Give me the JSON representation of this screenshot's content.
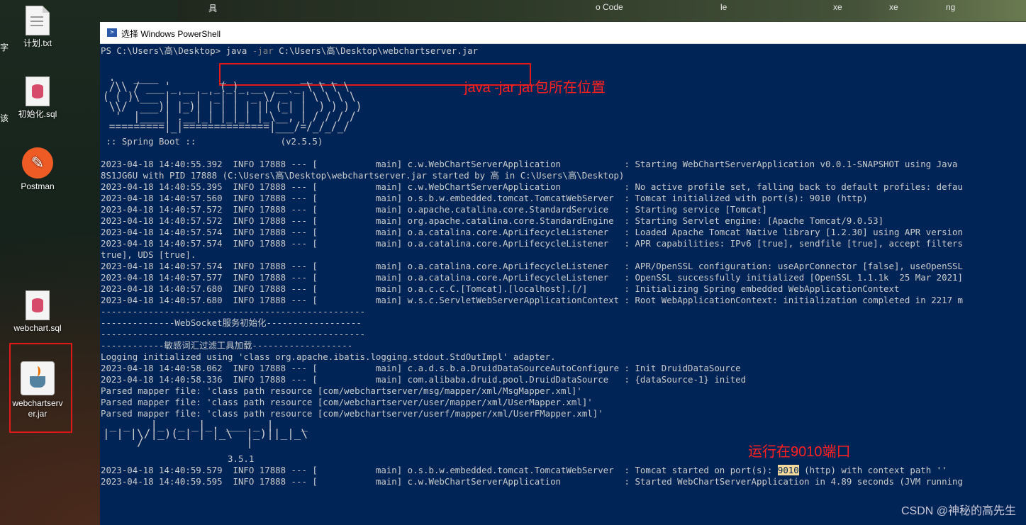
{
  "desktop": {
    "top_labels": [
      "具",
      "o Code",
      "le",
      "xe",
      "xe",
      "ng"
    ],
    "left_cut_labels": [
      "字",
      "该"
    ],
    "icons": [
      {
        "label": "计划.txt"
      },
      {
        "label": "初始化.sql"
      },
      {
        "label": "Postman"
      },
      {
        "label": "webchart.sql"
      },
      {
        "label": "webchartserver.jar"
      }
    ]
  },
  "window": {
    "title": "选择 Windows PowerShell"
  },
  "console": {
    "prompt": "PS C:\\Users\\高\\Desktop> ",
    "cmd_java": "java",
    "cmd_flag": " -jar",
    "cmd_path": " C:\\Users\\高\\Desktop\\webchartserver.jar",
    "spring_banner": " .   ____          _            __ _ _\n /\\\\ / ___'_ __ _ _(_)_ __  __ _ \\ \\ \\ \\\n( ( )\\___ | '_ | '_| | '_ \\/ _` | \\ \\ \\ \\\n \\\\/  ___)| |_)| | | | | || (_| |  ) ) ) )\n  '  |____| .__|_| |_|_| |_\\__, | / / / /\n =========|_|==============|___/=/_/_/_/",
    "spring_version": " :: Spring Boot ::                (v2.5.5)",
    "log_lines": [
      "2023-04-18 14:40:55.392  INFO 17888 --- [           main] c.w.WebChartServerApplication            : Starting WebChartServerApplication v0.0.1-SNAPSHOT using Java",
      "8S1JG6U with PID 17888 (C:\\Users\\高\\Desktop\\webchartserver.jar started by 高 in C:\\Users\\高\\Desktop)",
      "2023-04-18 14:40:55.395  INFO 17888 --- [           main] c.w.WebChartServerApplication            : No active profile set, falling back to default profiles: defau",
      "2023-04-18 14:40:57.560  INFO 17888 --- [           main] o.s.b.w.embedded.tomcat.TomcatWebServer  : Tomcat initialized with port(s): 9010 (http)",
      "2023-04-18 14:40:57.572  INFO 17888 --- [           main] o.apache.catalina.core.StandardService   : Starting service [Tomcat]",
      "2023-04-18 14:40:57.572  INFO 17888 --- [           main] org.apache.catalina.core.StandardEngine  : Starting Servlet engine: [Apache Tomcat/9.0.53]",
      "2023-04-18 14:40:57.574  INFO 17888 --- [           main] o.a.catalina.core.AprLifecycleListener   : Loaded Apache Tomcat Native library [1.2.30] using APR version",
      "2023-04-18 14:40:57.574  INFO 17888 --- [           main] o.a.catalina.core.AprLifecycleListener   : APR capabilities: IPv6 [true], sendfile [true], accept filters",
      "true], UDS [true].",
      "2023-04-18 14:40:57.574  INFO 17888 --- [           main] o.a.catalina.core.AprLifecycleListener   : APR/OpenSSL configuration: useAprConnector [false], useOpenSSL",
      "2023-04-18 14:40:57.577  INFO 17888 --- [           main] o.a.catalina.core.AprLifecycleListener   : OpenSSL successfully initialized [OpenSSL 1.1.1k  25 Mar 2021]",
      "2023-04-18 14:40:57.680  INFO 17888 --- [           main] o.a.c.c.C.[Tomcat].[localhost].[/]       : Initializing Spring embedded WebApplicationContext",
      "2023-04-18 14:40:57.680  INFO 17888 --- [           main] w.s.c.ServletWebServerApplicationContext : Root WebApplicationContext: initialization completed in 2217 m",
      "--------------------------------------------------",
      "--------------WebSocket服务初始化------------------",
      "--------------------------------------------------",
      "------------敏感词汇过滤工具加载-------------------",
      "Logging initialized using 'class org.apache.ibatis.logging.stdout.StdOutImpl' adapter.",
      "2023-04-18 14:40:58.062  INFO 17888 --- [           main] c.a.d.s.b.a.DruidDataSourceAutoConfigure : Init DruidDataSource",
      "2023-04-18 14:40:58.336  INFO 17888 --- [           main] com.alibaba.druid.pool.DruidDataSource   : {dataSource-1} inited",
      "Parsed mapper file: 'class path resource [com/webchartserver/msg/mapper/xml/MsgMapper.xml]'",
      "Parsed mapper file: 'class path resource [com/webchartserver/user/mapper/xml/UserMapper.xml]'",
      "Parsed mapper file: 'class path resource [com/webchartserver/userf/mapper/xml/UserFMapper.xml]'"
    ],
    "mybatis_banner": " _ _   |_  _ _|_. ___ _ |    _\n| | |\\/|_)(_| | |_\\  |_)||_|_\\\n     /               |",
    "mybatis_version": "                        3.5.1",
    "final_lines": [
      {
        "pre": "2023-04-18 14:40:59.579  INFO 17888 --- [           main] o.s.b.w.embedded.tomcat.TomcatWebServer  : Tomcat started on port(s): ",
        "port": "9010",
        "post": " (http) with context path ''"
      },
      {
        "pre": "2023-04-18 14:40:59.595  INFO 17888 --- [           main] c.w.WebChartServerApplication            : Started WebChartServerApplication in 4.89 seconds (JVM running",
        "port": "",
        "post": ""
      }
    ]
  },
  "annotations": {
    "cmd_note": "java -jar jar包所在位置",
    "port_note": "运行在9010端口"
  },
  "watermark": "CSDN @神秘的高先生",
  "colors": {
    "console_bg": "#012456",
    "console_text": "#cccccc",
    "annotation_red": "#ff2020",
    "highlight": "#f5d99a"
  }
}
